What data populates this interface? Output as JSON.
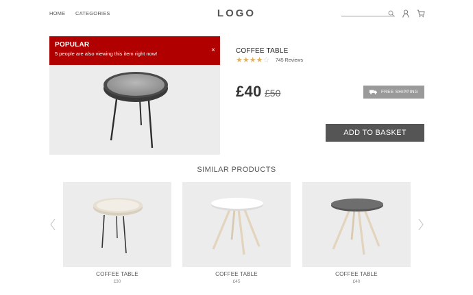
{
  "header": {
    "nav": [
      "HOME",
      "CATEGORIES"
    ],
    "logo": "LOGO",
    "search": {
      "placeholder": ""
    }
  },
  "banner": {
    "title": "POPULAR",
    "text": "5 people are also viewing this item right now!",
    "close": "×"
  },
  "product": {
    "title": "COFFEE TABLE",
    "rating": 4,
    "rating_max": 5,
    "reviews": "745 Reviews",
    "price": "£40",
    "old_price": "£50",
    "shipping": "FREE SHIPPING",
    "cta": "ADD TO BASKET"
  },
  "similar": {
    "title": "SIMILAR PRODUCTS",
    "items": [
      {
        "name": "COFFEE TABLE",
        "price": "£30"
      },
      {
        "name": "COFFEE TABLE",
        "price": "£45"
      },
      {
        "name": "COFFEE TABLE",
        "price": "£40"
      }
    ]
  },
  "colors": {
    "banner_red": "#b00000",
    "button_dark": "#555555",
    "shipping_gray": "#9a9a9a",
    "star_gold": "#e0b15c"
  }
}
